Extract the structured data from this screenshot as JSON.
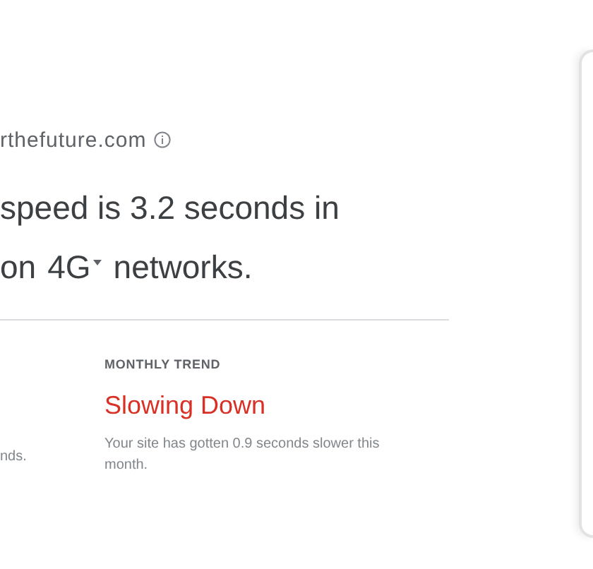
{
  "site": {
    "domain": "rthefuture.com"
  },
  "headline": {
    "lead": "speed is 3.2 seconds in",
    "prefix": "on",
    "network": "4G",
    "suffix": "networks."
  },
  "left_column": {
    "text": "nds."
  },
  "monthly_trend": {
    "label": "MONTHLY TREND",
    "status": "Slowing Down",
    "description": "Your site has gotten 0.9 seconds slower this month."
  }
}
